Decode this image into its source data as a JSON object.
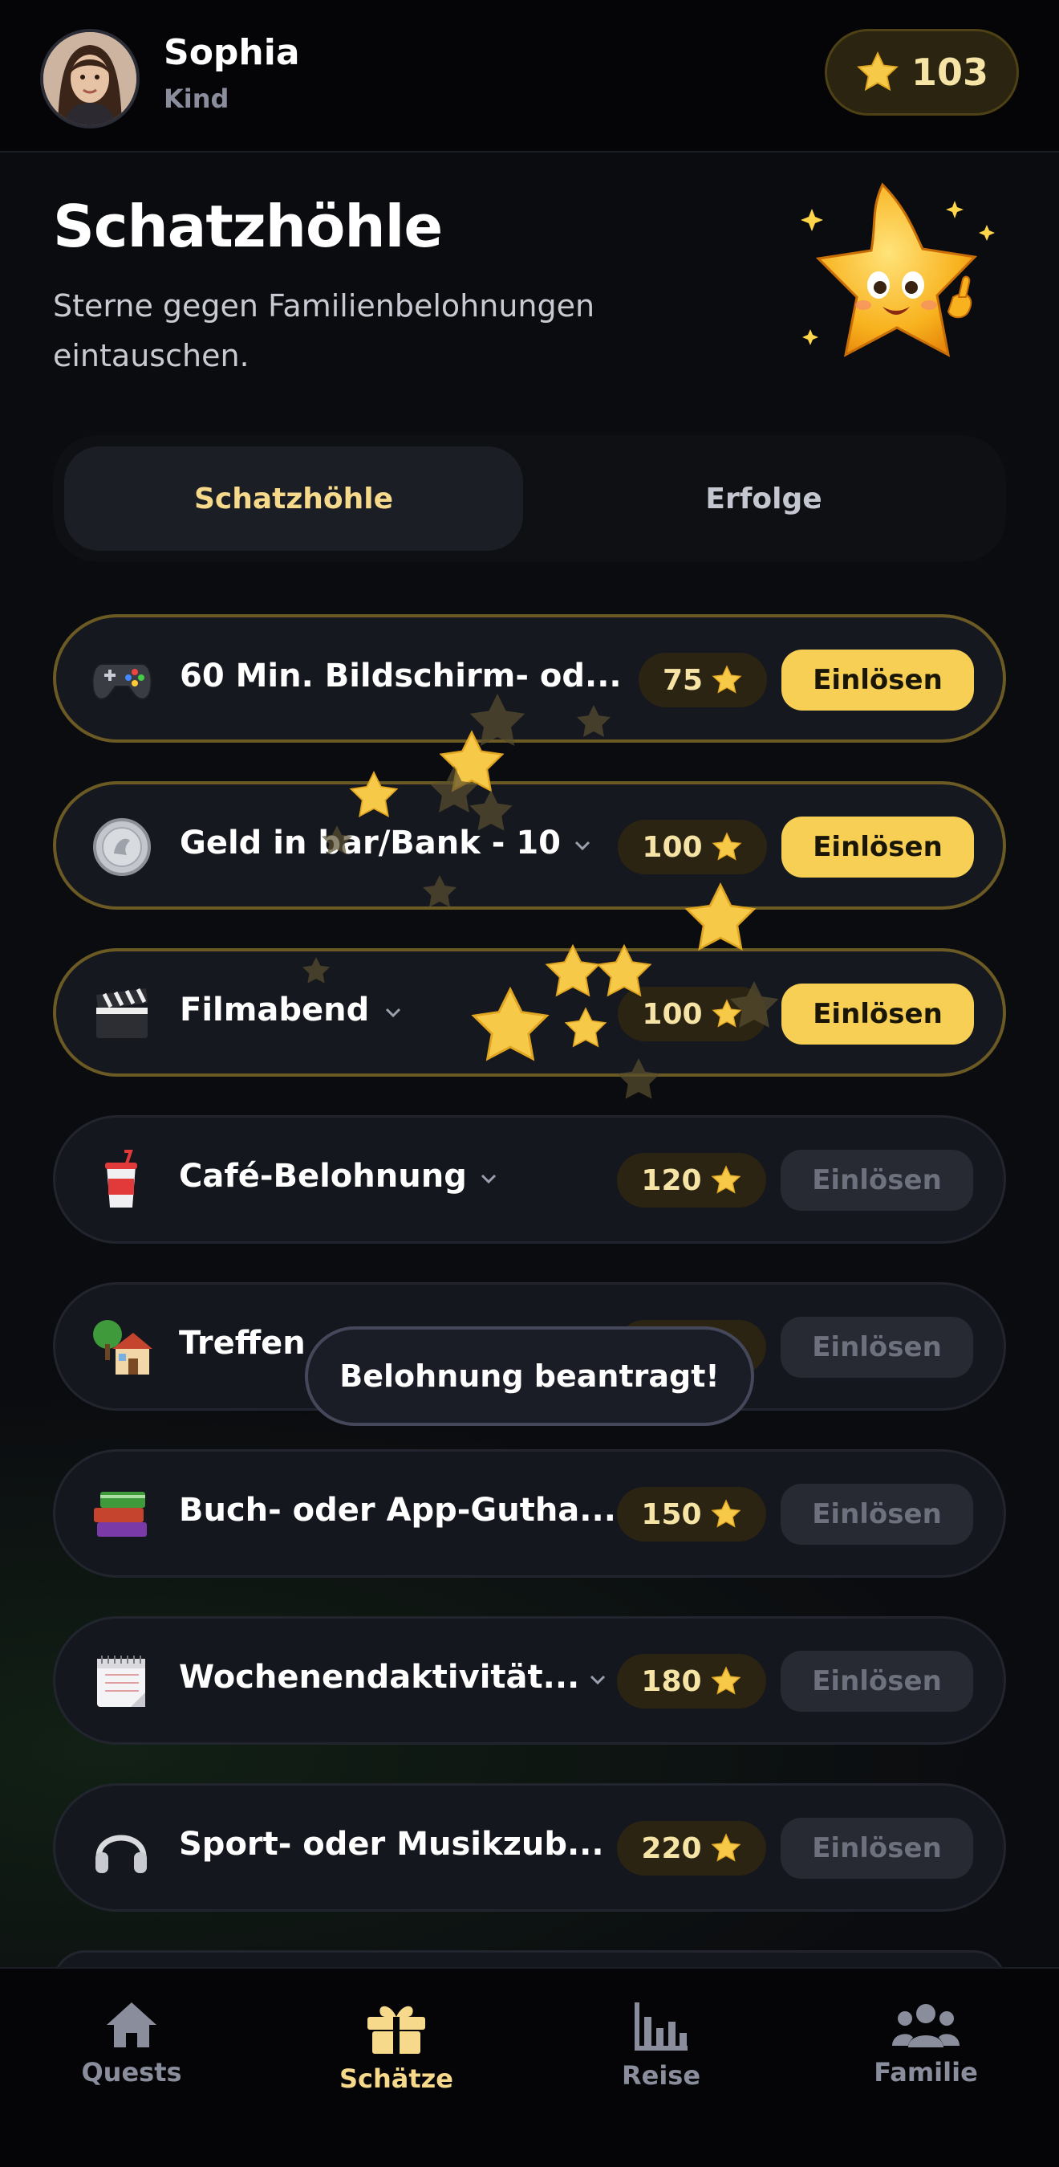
{
  "header": {
    "user_name": "Sophia",
    "user_role": "Kind",
    "star_count": "103"
  },
  "hero": {
    "title": "Schatzhöhle",
    "subtitle": "Sterne gegen Familienbelohnungen eintauschen."
  },
  "tabs": [
    {
      "label": "Schatzhöhle",
      "active": true
    },
    {
      "label": "Erfolge",
      "active": false
    }
  ],
  "rewards": [
    {
      "icon": "gamepad-icon",
      "title": "60 Min. Bildschirm- od...",
      "cost": "75",
      "action": "Einlösen",
      "state": "available"
    },
    {
      "icon": "coin-icon",
      "title": "Geld in bar/Bank - 10",
      "cost": "100",
      "action": "Einlösen",
      "state": "available"
    },
    {
      "icon": "clapperboard-icon",
      "title": "Filmabend",
      "cost": "100",
      "action": "Einlösen",
      "state": "available"
    },
    {
      "icon": "cup-icon",
      "title": "Café-Belohnung",
      "cost": "120",
      "action": "Einlösen",
      "state": "locked"
    },
    {
      "icon": "house-icon",
      "title": "Treffen",
      "cost": "",
      "action": "Einlösen",
      "state": "locked"
    },
    {
      "icon": "books-icon",
      "title": "Buch- oder App-Gutha...",
      "cost": "150",
      "action": "Einlösen",
      "state": "locked"
    },
    {
      "icon": "calendar-icon",
      "title": "Wochenendaktivität...",
      "cost": "180",
      "action": "Einlösen",
      "state": "locked"
    },
    {
      "icon": "headphones-icon",
      "title": "Sport- oder Musikzub...",
      "cost": "220",
      "action": "Einlösen",
      "state": "locked"
    }
  ],
  "toast": {
    "message": "Belohnung beantragt!"
  },
  "bottom_nav": [
    {
      "icon": "home-icon",
      "label": "Quests",
      "active": false
    },
    {
      "icon": "gift-icon",
      "label": "Schätze",
      "active": true
    },
    {
      "icon": "bar-chart-icon",
      "label": "Reise",
      "active": false
    },
    {
      "icon": "family-icon",
      "label": "Familie",
      "active": false
    }
  ],
  "colors": {
    "accent": "#f7cf55",
    "background": "#0b0c10",
    "card": "#15171e",
    "active_tab_text": "#f6d98a"
  }
}
